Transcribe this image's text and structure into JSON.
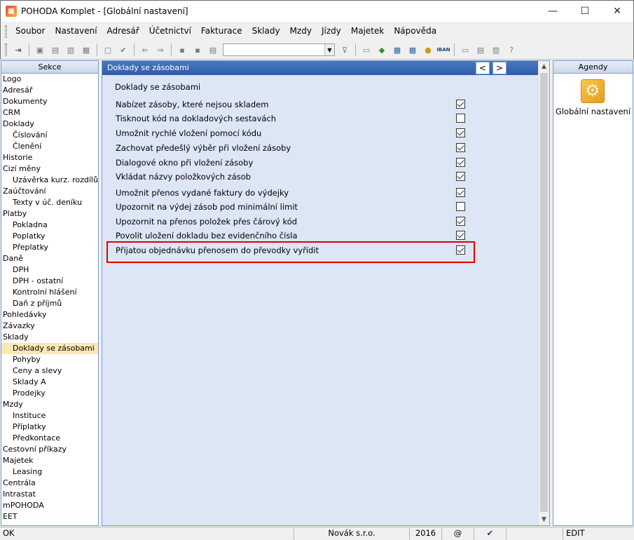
{
  "window": {
    "title": "POHODA Komplet - [Globální nastavení]",
    "minimize": "—",
    "maximize": "☐",
    "close": "✕"
  },
  "menu": [
    "Soubor",
    "Nastavení",
    "Adresář",
    "Účetnictví",
    "Fakturace",
    "Sklady",
    "Mzdy",
    "Jízdy",
    "Majetek",
    "Nápověda"
  ],
  "left_panel": {
    "header": "Sekce",
    "items": [
      {
        "label": "Logo",
        "level": 1
      },
      {
        "label": "Adresář",
        "level": 1
      },
      {
        "label": "Dokumenty",
        "level": 1
      },
      {
        "label": "CRM",
        "level": 1
      },
      {
        "label": "Doklady",
        "level": 1
      },
      {
        "label": "Číslování",
        "level": 2
      },
      {
        "label": "Členění",
        "level": 2
      },
      {
        "label": "Historie",
        "level": 1
      },
      {
        "label": "Cizí měny",
        "level": 1
      },
      {
        "label": "Uzávěrka kurz. rozdílů",
        "level": 2
      },
      {
        "label": "Zaúčtování",
        "level": 1
      },
      {
        "label": "Texty v úč. deníku",
        "level": 2
      },
      {
        "label": "Platby",
        "level": 1
      },
      {
        "label": "Pokladna",
        "level": 2
      },
      {
        "label": "Poplatky",
        "level": 2
      },
      {
        "label": "Přeplatky",
        "level": 2
      },
      {
        "label": "Daně",
        "level": 1
      },
      {
        "label": "DPH",
        "level": 2
      },
      {
        "label": "DPH - ostatní",
        "level": 2
      },
      {
        "label": "Kontrolní hlášení",
        "level": 2
      },
      {
        "label": "Daň z příjmů",
        "level": 2
      },
      {
        "label": "Pohledávky",
        "level": 1
      },
      {
        "label": "Závazky",
        "level": 1
      },
      {
        "label": "Sklady",
        "level": 1
      },
      {
        "label": "Doklady se zásobami",
        "level": 2,
        "selected": true
      },
      {
        "label": "Pohyby",
        "level": 2
      },
      {
        "label": "Ceny a slevy",
        "level": 2
      },
      {
        "label": "Sklady A",
        "level": 2
      },
      {
        "label": "Prodejky",
        "level": 2
      },
      {
        "label": "Mzdy",
        "level": 1
      },
      {
        "label": "Instituce",
        "level": 2
      },
      {
        "label": "Příplatky",
        "level": 2
      },
      {
        "label": "Předkontace",
        "level": 2
      },
      {
        "label": "Cestovní příkazy",
        "level": 1
      },
      {
        "label": "Majetek",
        "level": 1
      },
      {
        "label": "Leasing",
        "level": 2
      },
      {
        "label": "Centrála",
        "level": 1
      },
      {
        "label": "Intrastat",
        "level": 1
      },
      {
        "label": "mPOHODA",
        "level": 1
      },
      {
        "label": "EET",
        "level": 1
      }
    ]
  },
  "main": {
    "header": "Doklady se zásobami",
    "nav_prev": "<",
    "nav_next": ">",
    "group_title": "Doklady se zásobami",
    "options": [
      {
        "label": "Nabízet zásoby, které nejsou skladem",
        "checked": true
      },
      {
        "label": "Tisknout kód na dokladových sestavách",
        "checked": false
      },
      {
        "label": "Umožnit rychlé vložení pomocí kódu",
        "checked": true
      },
      {
        "label": "Zachovat předešlý výběr při vložení zásoby",
        "checked": true
      },
      {
        "label": "Dialogové okno při vložení zásoby",
        "checked": true
      },
      {
        "label": "Vkládat názvy položkových zásob",
        "checked": true
      },
      {
        "label": "Umožnit přenos vydané faktury do výdejky",
        "checked": true
      },
      {
        "label": "Upozornit na výdej zásob pod minimální limit",
        "checked": false
      },
      {
        "label": "Upozornit na přenos položek přes čárový kód",
        "checked": true
      },
      {
        "label": "Povolit uložení dokladu bez evidenčního čísla",
        "checked": true
      },
      {
        "label": "Přijatou objednávku přenosem do převodky vyřídit",
        "checked": true
      }
    ]
  },
  "right_panel": {
    "header": "Agendy",
    "item": "Globální nastavení"
  },
  "status": {
    "left": "OK",
    "company": "Novák s.r.o.",
    "year": "2016",
    "at": "@",
    "check": "✔",
    "edit": "EDIT"
  }
}
